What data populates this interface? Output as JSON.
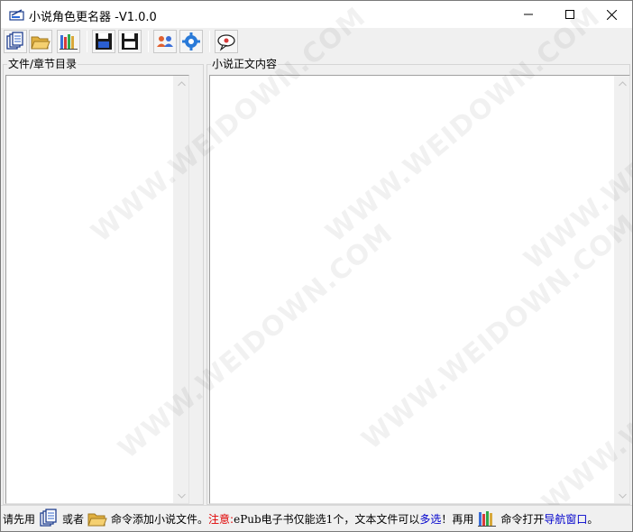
{
  "window": {
    "title": "小说角色更名器  -V1.0.0"
  },
  "toolbar": {
    "buttons": [
      {
        "name": "add-files",
        "icon": "documents-icon"
      },
      {
        "name": "open-folder",
        "icon": "folder-icon"
      },
      {
        "name": "navigation",
        "icon": "books-icon"
      },
      {
        "name": "save-blue",
        "icon": "save-icon"
      },
      {
        "name": "save-black",
        "icon": "save-as-icon"
      },
      {
        "name": "characters",
        "icon": "people-icon"
      },
      {
        "name": "settings",
        "icon": "gear-icon"
      },
      {
        "name": "about",
        "icon": "speech-bubble-icon"
      }
    ]
  },
  "panels": {
    "left_label": "文件/章节目录",
    "right_label": "小说正文内容"
  },
  "watermark": "WWW.WEIDOWN.COM",
  "status": {
    "part1": "请先用",
    "part2": "或者",
    "part3": "命令添加小说文件。",
    "note_label": "注意:",
    "part4": "ePub电子书仅能选1个，文本文件可以",
    "multi": "多选",
    "part5": "！再用",
    "part6": "命令打开",
    "nav": "导航窗口",
    "part7": "。"
  },
  "colors": {
    "note": "#e00000",
    "link": "#0000cc"
  }
}
